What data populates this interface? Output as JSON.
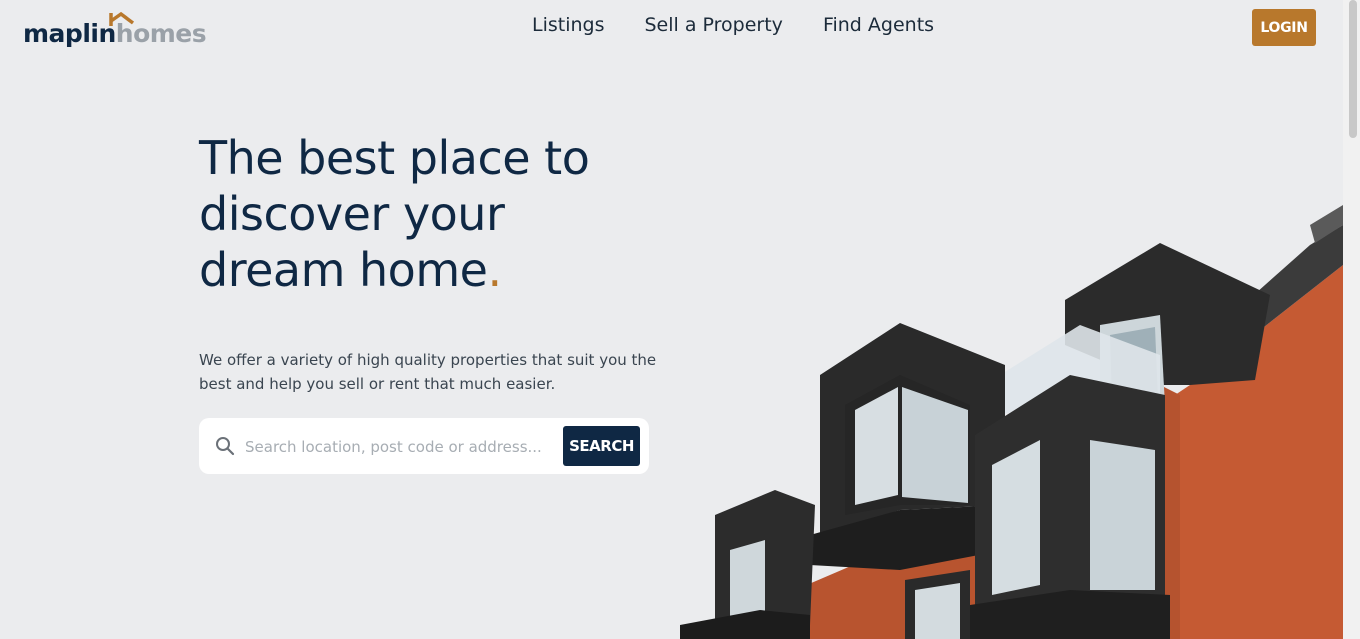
{
  "header": {
    "logo": {
      "part1": "maplin",
      "part2": "homes"
    },
    "nav": [
      {
        "label": "Listings"
      },
      {
        "label": "Sell a Property"
      },
      {
        "label": "Find Agents"
      }
    ],
    "login_label": "LOGIN"
  },
  "hero": {
    "headline_line1": "The best place to",
    "headline_line2": "discover your",
    "headline_line3": "dream home",
    "headline_dot": ".",
    "subtext": "We offer a variety of high quality properties that suit you the best and help you sell or rent that much easier.",
    "search": {
      "placeholder": "Search location, post code or address...",
      "button_label": "SEARCH"
    }
  },
  "colors": {
    "brand_navy": "#0f2844",
    "accent_gold": "#b8782c",
    "background": "#ebecee"
  },
  "icons": [
    "house-roof-logo-icon",
    "search-icon"
  ]
}
